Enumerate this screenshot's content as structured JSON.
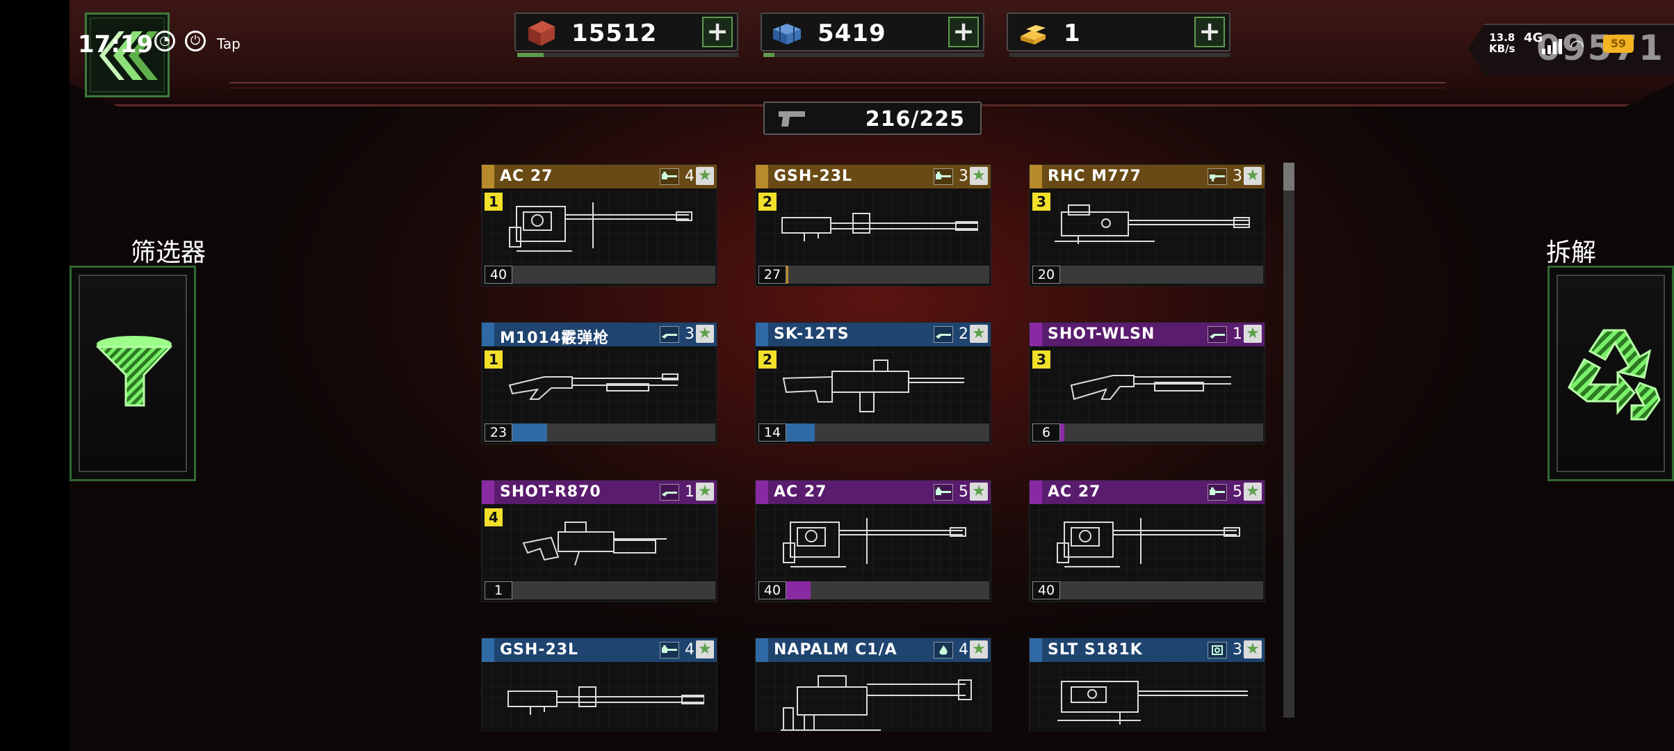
{
  "status_bar": {
    "time": "17:19",
    "tap_label": "Tap",
    "net_speed": "13.8\nKB/s",
    "net_type": "4G",
    "battery": "59",
    "player_id": "09571"
  },
  "currencies": [
    {
      "value": "15512",
      "icon": "crate-icon",
      "plus": "+",
      "progress": 0.12
    },
    {
      "value": "5419",
      "icon": "blue-cubes-icon",
      "plus": "+",
      "progress": 0.05
    },
    {
      "value": "1",
      "icon": "gold-bars-icon",
      "plus": "+",
      "progress": 0
    }
  ],
  "weapon_counter": {
    "value": "216/225",
    "icon": "pistol-icon"
  },
  "filter": {
    "label": "筛选器",
    "icon": "funnel-icon"
  },
  "dismantle": {
    "label": "拆解",
    "icon": "recycle-icon"
  },
  "colors": {
    "gold": "#b98a2c",
    "blue": "#2f6aa6",
    "purple": "#8a2aa2",
    "green": "#5f9a4f"
  },
  "cards": [
    {
      "name": "AC 27",
      "rarity": "gold",
      "type_icon": "autocannon-icon",
      "stars": "4",
      "rank": "1",
      "level": "40",
      "fill": 0,
      "weapon": "autocannon"
    },
    {
      "name": "GSH-23L",
      "rarity": "gold",
      "type_icon": "autocannon-icon",
      "stars": "3",
      "rank": "2",
      "level": "27",
      "fill": 0.01,
      "weapon": "longgun"
    },
    {
      "name": "RHC M777",
      "rarity": "gold",
      "type_icon": "cannon-icon",
      "stars": "3",
      "rank": "3",
      "level": "20",
      "fill": 0,
      "weapon": "heavygun"
    },
    {
      "name": "M1014霰弹枪",
      "rarity": "blue",
      "type_icon": "shotgun-icon",
      "stars": "3",
      "rank": "1",
      "level": "23",
      "fill": 0.17,
      "weapon": "shotgun"
    },
    {
      "name": "SK-12TS",
      "rarity": "blue",
      "type_icon": "shotgun-icon",
      "stars": "2",
      "rank": "2",
      "level": "14",
      "fill": 0.14,
      "weapon": "bullpup"
    },
    {
      "name": "SHOT-WLSN",
      "rarity": "purple",
      "type_icon": "shotgun-icon",
      "stars": "1",
      "rank": "3",
      "level": "6",
      "fill": 0.02,
      "weapon": "pump"
    },
    {
      "name": "SHOT-R870",
      "rarity": "purple",
      "type_icon": "shotgun-icon",
      "stars": "1",
      "rank": "4",
      "level": "1",
      "fill": 0,
      "weapon": "tactical"
    },
    {
      "name": "AC 27",
      "rarity": "purple",
      "type_icon": "autocannon-icon",
      "stars": "5",
      "rank": "",
      "level": "40",
      "fill": 0.12,
      "weapon": "autocannon"
    },
    {
      "name": "AC 27",
      "rarity": "purple",
      "type_icon": "autocannon-icon",
      "stars": "5",
      "rank": "",
      "level": "40",
      "fill": 0,
      "weapon": "autocannon"
    },
    {
      "name": "GSH-23L",
      "rarity": "blue",
      "type_icon": "autocannon-icon",
      "stars": "4",
      "rank": "",
      "level": "",
      "fill": 0,
      "weapon": "longgun"
    },
    {
      "name": "NAPALM C1/A",
      "rarity": "blue",
      "type_icon": "fire-icon",
      "stars": "4",
      "rank": "",
      "level": "",
      "fill": 0,
      "weapon": "flamer"
    },
    {
      "name": "SLT S181K",
      "rarity": "blue",
      "type_icon": "target-icon",
      "stars": "3",
      "rank": "",
      "level": "",
      "fill": 0,
      "weapon": "sniper"
    }
  ]
}
